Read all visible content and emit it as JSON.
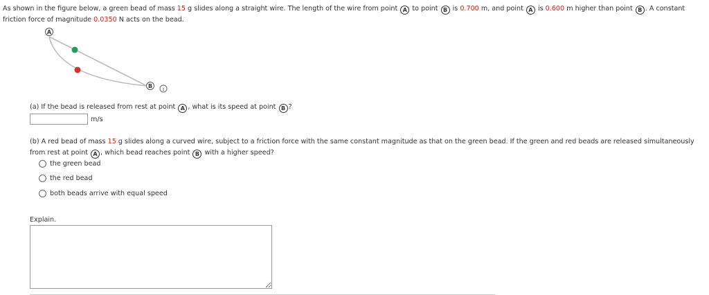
{
  "intro": {
    "t1": "As shown in the figure below, a green bead of mass ",
    "mass": "15",
    "t2": " g slides along a straight wire. The length of the wire from point ",
    "pointA": "A",
    "t3": " to point ",
    "pointB": "B",
    "t4": " is ",
    "length": "0.700",
    "t5": " m, and point ",
    "t6": " is ",
    "height": "0.600",
    "t7": " m higher than point ",
    "t8": ". A constant friction force of magnitude ",
    "friction": "0.0350",
    "t9": " N acts on the bead."
  },
  "figure": {
    "label_a": "A",
    "label_b": "B",
    "info_icon_text": "i",
    "green_bead_color": "#1f9d63",
    "red_bead_color": "#d0342c",
    "wire_color": "#bdbdbd"
  },
  "part_a": {
    "q1": "(a) If the bead is released from rest at point ",
    "q2": ", what is its speed at point ",
    "q3": "?",
    "input_value": "",
    "unit": "m/s"
  },
  "part_b": {
    "q1": "(b) A red bead of mass ",
    "mass": "15",
    "q2": " g slides along a curved wire, subject to a friction force with the same constant magnitude as that on the green bead. If the green and red beads are released simultaneously from rest at point ",
    "q3": ", which bead reaches point ",
    "q4": " with a higher speed?",
    "options": [
      "the green bead",
      "the red bead",
      "both beads arrive with equal speed"
    ]
  },
  "explain": {
    "label": "Explain.",
    "value": ""
  }
}
